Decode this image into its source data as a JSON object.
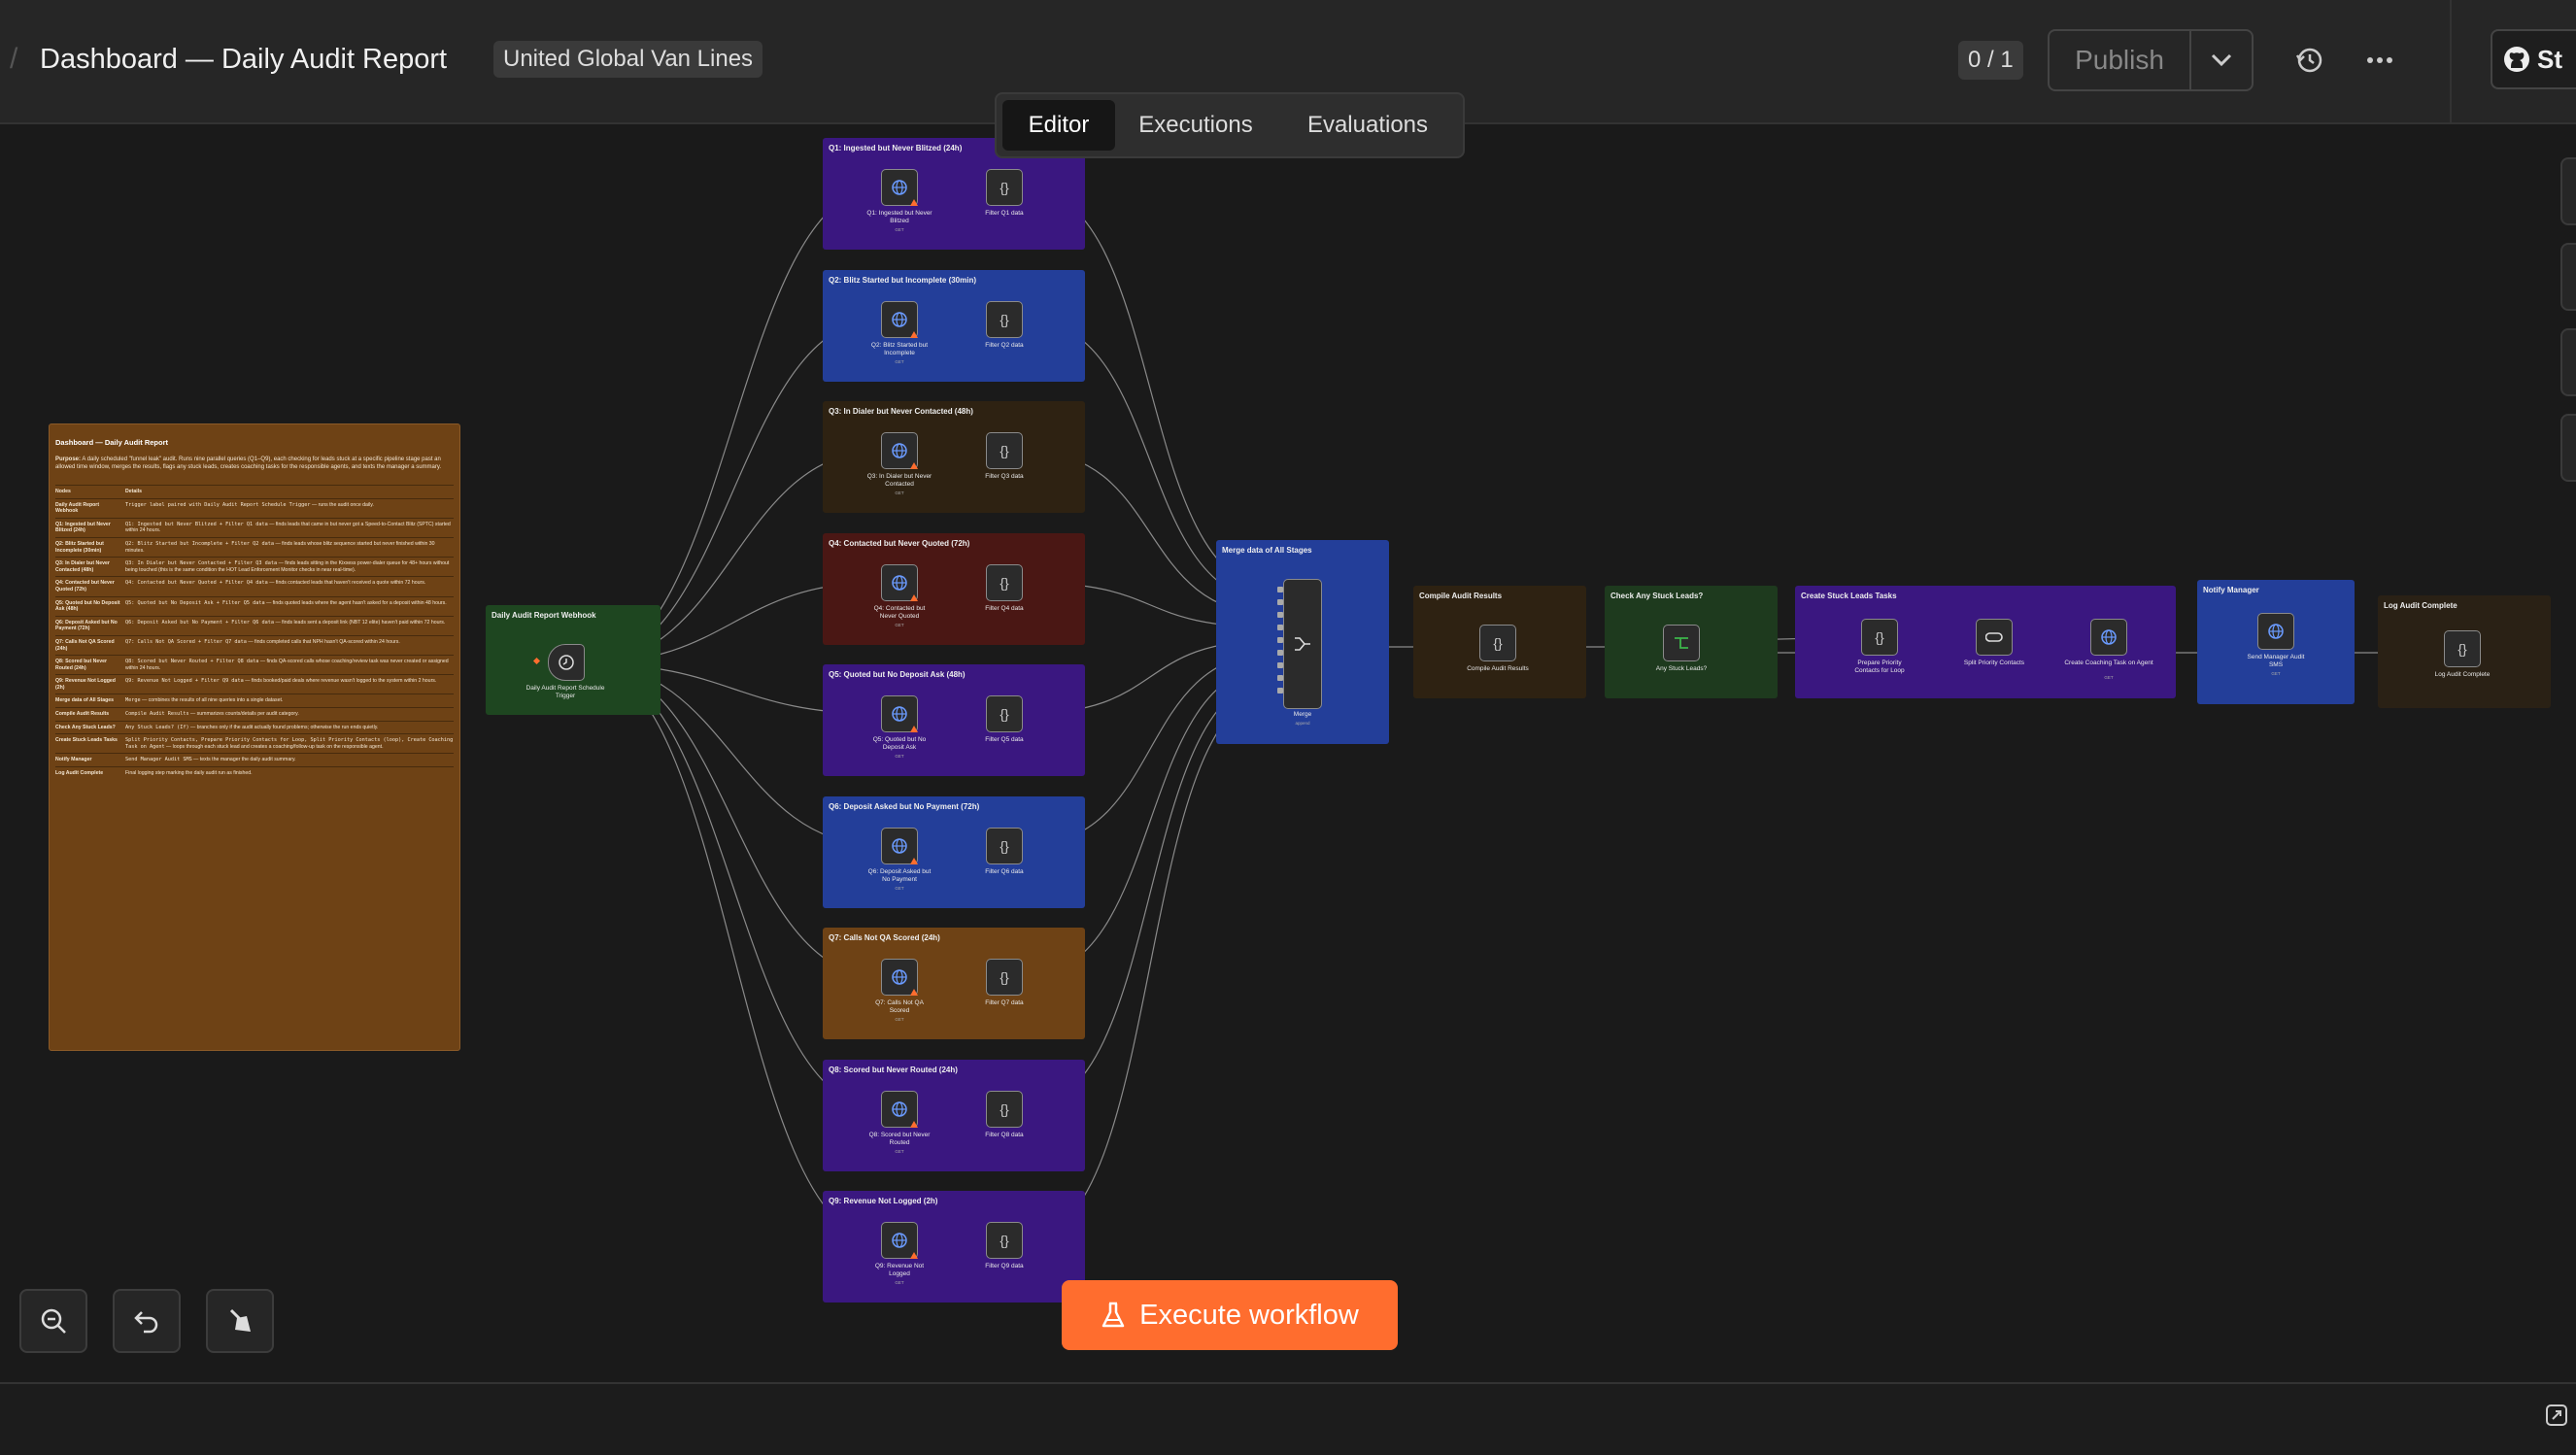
{
  "header": {
    "title": "Dashboard — Daily Audit Report",
    "project_tag": "United Global Van Lines",
    "counter": "0 / 1",
    "publish_label": "Publish",
    "github_label": "St"
  },
  "tabs": [
    {
      "label": "Editor",
      "active": true
    },
    {
      "label": "Executions",
      "active": false
    },
    {
      "label": "Evaluations",
      "active": false
    }
  ],
  "execute_button": {
    "label": "Execute workflow"
  },
  "notes": {
    "title": "Dashboard — Daily Audit Report",
    "purpose_label": "Purpose:",
    "purpose": "A daily scheduled \"funnel leak\" audit. Runs nine parallel queries (Q1–Q9), each checking for leads stuck at a specific pipeline stage past an allowed time window, merges the results, flags any stuck leads, creates coaching tasks for the responsible agents, and texts the manager a summary.",
    "col_nodes": "Nodes",
    "col_details": "Details",
    "rows": [
      {
        "k": "Daily Audit Report Webhook",
        "code": "Trigger label paired with Daily Audit Report Schedule Trigger",
        "v": " — runs the audit once daily."
      },
      {
        "k": "Q1: Ingested but Never Blitzed (24h)",
        "code": "Q1: Ingested but Never Blitzed + Filter Q1 data",
        "v": " — finds leads that came in but never got a Speed-to-Contact Blitz (SPTC) started within 24 hours."
      },
      {
        "k": "Q2: Blitz Started but Incomplete (30min)",
        "code": "Q2: Blitz Started but Incomplete + Filter Q2 data",
        "v": " — finds leads whose blitz sequence started but never finished within 30 minutes."
      },
      {
        "k": "Q3: In Dialer but Never Contacted (48h)",
        "code": "Q3: In Dialer but Never Contacted + Filter Q3 data",
        "v": " — finds leads sitting in the Kixxess power-dialer queue for 48+ hours without being touched (this is the same condition the HOT Lead Enforcement Monitor checks in near real-time)."
      },
      {
        "k": "Q4: Contacted but Never Quoted (72h)",
        "code": "Q4: Contacted but Never Quoted + Filter Q4 data",
        "v": " — finds contacted leads that haven't received a quote within 72 hours."
      },
      {
        "k": "Q5: Quoted but No Deposit Ask (48h)",
        "code": "Q5: Quoted but No Deposit Ask + Filter Q5 data",
        "v": " — finds quoted leads where the agent hasn't asked for a deposit within 48 hours."
      },
      {
        "k": "Q6: Deposit Asked but No Payment (72h)",
        "code": "Q6: Deposit Asked but No Payment + Filter Q6 data",
        "v": " — finds leads sent a deposit link (NBT 12 elite) haven't paid within 72 hours."
      },
      {
        "k": "Q7: Calls Not QA Scored (24h)",
        "code": "Q7: Calls Not QA Scored + Filter Q7 data",
        "v": " — finds completed calls that NPH hasn't QA-scored within 24 hours."
      },
      {
        "k": "Q8: Scored but Never Routed (24h)",
        "code": "Q8: Scored but Never Routed + Filter Q8 data",
        "v": " — finds QA-scored calls whose coaching/review task was never created or assigned within 24 hours."
      },
      {
        "k": "Q9: Revenue Not Logged (2h)",
        "code": "Q9: Revenue Not Logged + Filter Q9 data",
        "v": " — finds booked/paid deals where revenue wasn't logged to the system within 2 hours."
      },
      {
        "k": "Merge data of All Stages",
        "code": "Merge",
        "v": " — combines the results of all nine queries into a single dataset."
      },
      {
        "k": "Compile Audit Results",
        "code": "Compile Audit Results",
        "v": " — summarizes counts/details per audit category."
      },
      {
        "k": "Check Any Stuck Leads?",
        "code": "Any Stuck Leads? (If)",
        "v": " — branches only if the audit actually found problems; otherwise the run ends quietly."
      },
      {
        "k": "Create Stuck Leads Tasks",
        "code": "Split Priority Contacts, Prepare Priority Contacts for Loop, Split Priority Contacts (loop), Create Coaching Task on Agent",
        "v": " — loops through each stuck lead and creates a coaching/follow-up task on the responsible agent."
      },
      {
        "k": "Notify Manager",
        "code": "Send Manager Audit SMS",
        "v": " — texts the manager the daily audit summary."
      },
      {
        "k": "Log Audit Complete",
        "code": "",
        "v": "Final logging step marking the daily audit run as finished."
      }
    ]
  },
  "trigger": {
    "group_title": "Daily Audit Report Webhook",
    "node_label": "Daily Audit Report Schedule Trigger",
    "color": "#1e4620"
  },
  "query_groups": [
    {
      "title": "Q1: Ingested but Never Blitzed (24h)",
      "http_label": "Q1: Ingested but Never Blitzed",
      "filter_label": "Filter Q1 data",
      "method": "GET",
      "color": "#3a1780"
    },
    {
      "title": "Q2: Blitz Started but Incomplete (30min)",
      "http_label": "Q2: Blitz Started but Incomplete",
      "filter_label": "Filter Q2 data",
      "method": "GET",
      "color": "#233e99"
    },
    {
      "title": "Q3: In Dialer but Never Contacted (48h)",
      "http_label": "Q3: In Dialer but Never Contacted",
      "filter_label": "Filter Q3 data",
      "method": "GET",
      "color": "#2e2212"
    },
    {
      "title": "Q4: Contacted but Never Quoted (72h)",
      "http_label": "Q4: Contacted but Never Quoted",
      "filter_label": "Filter Q4 data",
      "method": "GET",
      "color": "#4a1714"
    },
    {
      "title": "Q5: Quoted but No Deposit Ask (48h)",
      "http_label": "Q5: Quoted but No Deposit Ask",
      "filter_label": "Filter Q5 data",
      "method": "GET",
      "color": "#3a1780"
    },
    {
      "title": "Q6: Deposit Asked but No Payment (72h)",
      "http_label": "Q6: Deposit Asked but No Payment",
      "filter_label": "Filter Q6 data",
      "method": "GET",
      "color": "#233e99"
    },
    {
      "title": "Q7: Calls Not QA Scored (24h)",
      "http_label": "Q7: Calls Not QA Scored",
      "filter_label": "Filter Q7 data",
      "method": "GET",
      "color": "#6e4215"
    },
    {
      "title": "Q8: Scored but Never Routed (24h)",
      "http_label": "Q8: Scored but Never Routed",
      "filter_label": "Filter Q8 data",
      "method": "GET",
      "color": "#3a1780"
    },
    {
      "title": "Q9: Revenue Not Logged (2h)",
      "http_label": "Q9: Revenue Not Logged",
      "filter_label": "Filter Q9 data",
      "method": "GET",
      "color": "#3a1780"
    }
  ],
  "merge": {
    "group_title": "Merge data of All Stages",
    "node_label": "Merge",
    "sub": "append",
    "color": "#233e99"
  },
  "compile": {
    "group_title": "Compile Audit Results",
    "node_label": "Compile Audit Results",
    "color": "#2e2212"
  },
  "check": {
    "group_title": "Check Any Stuck Leads?",
    "node_label": "Any Stuck Leads?",
    "color": "#1e3a1e"
  },
  "tasks": {
    "group_title": "Create Stuck Leads Tasks",
    "prepare_label": "Prepare Priority Contacts for Loop",
    "split_label": "Split Priority Contacts",
    "coaching_label": "Create Coaching Task on Agent",
    "coaching_method": "GET",
    "color": "#3a1780"
  },
  "notify": {
    "group_title": "Notify Manager",
    "node_label": "Send Manager Audit SMS",
    "method": "GET",
    "color": "#233e99"
  },
  "log": {
    "group_title": "Log Audit Complete",
    "node_label": "Log Audit Complete",
    "color": "#2a2115"
  },
  "colors": {
    "accent": "#ff6d2e",
    "notes_bg": "#6e4215"
  }
}
